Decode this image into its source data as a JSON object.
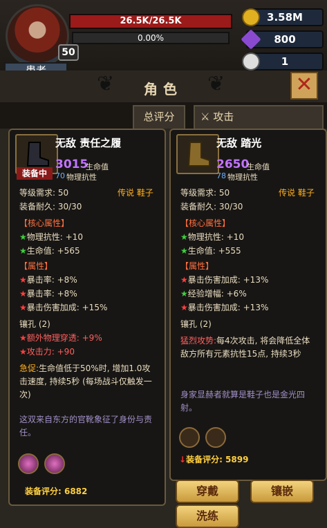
{
  "player": {
    "name": "患者",
    "level": "50",
    "hp": "26.5K/26.5K",
    "exp": "0.00%"
  },
  "resources": {
    "gold": "3.58M",
    "gems": "800",
    "keys": "1"
  },
  "screen_title": "角色",
  "tabs": {
    "score": "总评分",
    "attack": "攻击"
  },
  "equipped_item": {
    "name": "无敌 责任之履",
    "badge": "装备中",
    "hp_value": "3015",
    "hp_label": "生命值",
    "res_value": "70",
    "res_label": "物理抗性",
    "level_req": "等级需求: 50",
    "type": "传说 鞋子",
    "durability": "装备耐久: 30/30",
    "core_header": "【核心属性】",
    "core": [
      "物理抗性: +10",
      "生命值: +565"
    ],
    "attr_header": "【属性】",
    "attrs": [
      "暴击率: +8%",
      "暴击率: +8%",
      "暴击伤害加成: +15%"
    ],
    "socket_header": "镶孔 (2)",
    "sockets": [
      "额外物理穿透: +9%",
      "攻击力: +90"
    ],
    "skill_name": "急促:",
    "skill_text": "生命值低于50%时, 增加1.0攻击速度, 持续5秒 (每场战斗仅触发一次)",
    "flavor": "这双来自东方的官靴象征了身份与责任。",
    "score": "装备评分: 6882"
  },
  "compare_item": {
    "name": "无敌 踏光",
    "hp_value": "2650",
    "hp_label": "生命值",
    "res_value": "78",
    "res_label": "物理抗性",
    "level_req": "等级需求: 50",
    "type": "传说 鞋子",
    "durability": "装备耐久: 30/30",
    "core_header": "【核心属性】",
    "core": [
      "物理抗性: +10",
      "生命值: +555"
    ],
    "attr_header": "【属性】",
    "attrs": [
      "暴击伤害加成: +13%",
      "经验增幅: +6%",
      "暴击伤害加成: +13%"
    ],
    "socket_header": "镶孔 (2)",
    "skill_name": "猛烈攻势:",
    "skill_text": "每4次攻击, 将会降低全体敌方所有元素抗性15点, 持续3秒",
    "flavor": "身家显赫者就算是鞋子也是金光四射。",
    "score": "装备评分: 5899"
  },
  "buttons": {
    "wear": "穿戴",
    "inlay": "镶嵌",
    "reroll": "洗练"
  },
  "colors": {
    "hp_bar": "#9b1a1a",
    "gold": "#ffd040",
    "button": "#e8c060",
    "legendary": "#ffb020"
  }
}
